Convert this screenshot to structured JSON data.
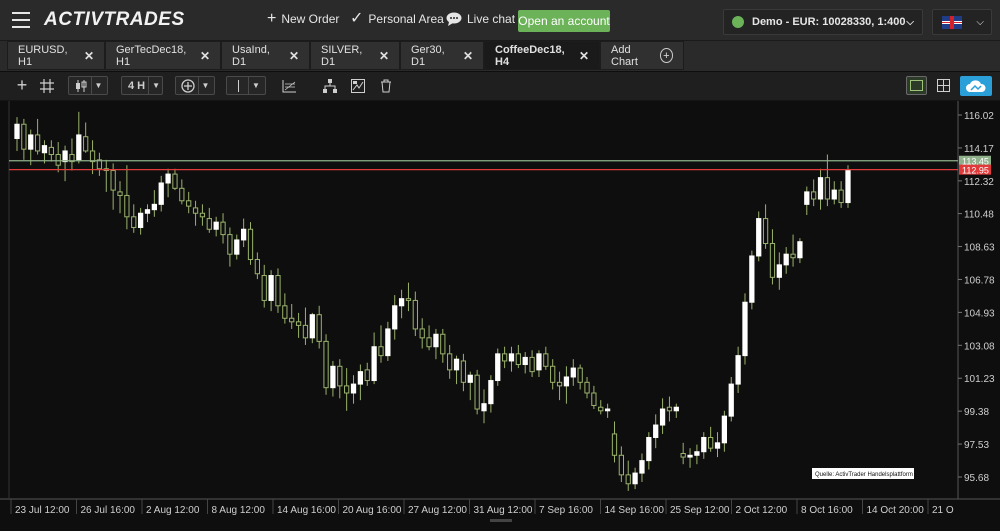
{
  "header": {
    "logo": "ACTIVTRADES",
    "new_order": "New Order",
    "personal_area": "Personal Area",
    "live_chat": "Live chat",
    "open_account": "Open an account",
    "account": "Demo - EUR: 10028330, 1:400"
  },
  "tabs": [
    {
      "label": "EURUSD, H1"
    },
    {
      "label": "GerTecDec18, H1"
    },
    {
      "label": "UsaInd, D1"
    },
    {
      "label": "SILVER, D1"
    },
    {
      "label": "Ger30, D1"
    },
    {
      "label": "CoffeeDec18, H4"
    }
  ],
  "add_chart": "Add Chart",
  "toolbar": {
    "timeframe": "4 H"
  },
  "chart_data": {
    "type": "candlestick",
    "y_ticks": [
      116.02,
      114.17,
      112.32,
      110.48,
      108.63,
      106.78,
      104.93,
      103.08,
      101.23,
      99.38,
      97.53,
      95.68
    ],
    "ylim": [
      94.5,
      116.8
    ],
    "x_ticks": [
      "23 Jul 12:00",
      "26 Jul 16:00",
      "2 Aug 12:00",
      "8 Aug 12:00",
      "14 Aug 16:00",
      "20 Aug 16:00",
      "27 Aug 12:00",
      "31 Aug 12:00",
      "7 Sep 16:00",
      "14 Sep 16:00",
      "25 Sep 12:00",
      "2 Oct 12:00",
      "8 Oct 16:00",
      "14 Oct 20:00",
      "21 O"
    ],
    "lines": [
      {
        "price": 113.45,
        "label": "113.45",
        "color": "#8fb08a"
      },
      {
        "price": 112.95,
        "label": "112.95",
        "color": "#e03a3a"
      }
    ],
    "watermark": "Quelle: ActivTrader Handelsplattform",
    "candles": [
      [
        114.7,
        115.9,
        114.0,
        115.5
      ],
      [
        115.5,
        115.8,
        113.5,
        114.1
      ],
      [
        114.1,
        115.2,
        113.2,
        114.9
      ],
      [
        114.9,
        115.8,
        113.8,
        114.0
      ],
      [
        113.9,
        114.6,
        113.3,
        114.3
      ],
      [
        114.2,
        114.6,
        113.4,
        113.8
      ],
      [
        113.8,
        114.5,
        112.8,
        113.2
      ],
      [
        113.4,
        114.3,
        112.3,
        114.0
      ],
      [
        113.8,
        114.7,
        112.9,
        113.4
      ],
      [
        113.5,
        116.2,
        113.3,
        114.9
      ],
      [
        114.8,
        115.6,
        113.9,
        114.0
      ],
      [
        114.0,
        114.6,
        112.7,
        113.4
      ],
      [
        113.5,
        113.9,
        112.6,
        113.0
      ],
      [
        113.0,
        113.5,
        111.7,
        112.9
      ],
      [
        112.9,
        113.3,
        110.7,
        111.8
      ],
      [
        111.7,
        112.3,
        110.5,
        111.5
      ],
      [
        111.5,
        113.2,
        109.6,
        110.3
      ],
      [
        110.3,
        111.0,
        109.4,
        109.7
      ],
      [
        109.7,
        110.8,
        109.3,
        110.5
      ],
      [
        110.5,
        111.0,
        110.0,
        110.7
      ],
      [
        110.7,
        111.8,
        110.3,
        111.0
      ],
      [
        111.0,
        112.6,
        110.6,
        112.2
      ],
      [
        112.2,
        113.0,
        111.4,
        112.7
      ],
      [
        112.7,
        113.0,
        111.8,
        111.9
      ],
      [
        111.9,
        112.4,
        111.0,
        111.2
      ],
      [
        111.2,
        111.7,
        110.5,
        110.9
      ],
      [
        110.8,
        111.2,
        109.8,
        110.5
      ],
      [
        110.5,
        111.0,
        109.8,
        110.3
      ],
      [
        110.2,
        110.8,
        109.4,
        109.6
      ],
      [
        109.6,
        110.3,
        109.2,
        110.0
      ],
      [
        110.0,
        110.5,
        108.8,
        109.3
      ],
      [
        109.3,
        109.7,
        107.5,
        108.2
      ],
      [
        108.2,
        109.3,
        107.9,
        109.0
      ],
      [
        109.0,
        110.2,
        108.6,
        109.6
      ],
      [
        109.6,
        110.0,
        107.6,
        107.9
      ],
      [
        107.9,
        108.3,
        106.8,
        107.1
      ],
      [
        107.0,
        107.6,
        105.2,
        105.6
      ],
      [
        105.6,
        107.3,
        105.0,
        107.0
      ],
      [
        107.0,
        107.4,
        104.9,
        105.3
      ],
      [
        105.3,
        106.0,
        104.3,
        104.6
      ],
      [
        104.6,
        105.4,
        104.0,
        104.4
      ],
      [
        104.4,
        104.9,
        103.5,
        104.2
      ],
      [
        104.2,
        105.2,
        103.1,
        103.5
      ],
      [
        103.5,
        104.9,
        103.2,
        104.8
      ],
      [
        104.8,
        105.3,
        102.9,
        103.3
      ],
      [
        103.3,
        103.7,
        100.3,
        100.7
      ],
      [
        100.7,
        102.2,
        100.2,
        101.9
      ],
      [
        101.9,
        102.3,
        100.1,
        100.8
      ],
      [
        100.8,
        101.8,
        99.4,
        100.4
      ],
      [
        100.4,
        101.4,
        99.8,
        100.9
      ],
      [
        100.9,
        102.0,
        100.0,
        101.6
      ],
      [
        101.7,
        102.1,
        100.8,
        101.1
      ],
      [
        101.1,
        103.8,
        100.9,
        103.0
      ],
      [
        103.0,
        104.2,
        102.1,
        102.5
      ],
      [
        102.5,
        104.4,
        102.2,
        104.0
      ],
      [
        104.0,
        105.9,
        103.4,
        105.3
      ],
      [
        105.3,
        106.2,
        104.6,
        105.7
      ],
      [
        105.7,
        106.6,
        105.0,
        105.6
      ],
      [
        105.6,
        106.1,
        103.6,
        104.0
      ],
      [
        104.0,
        104.6,
        102.9,
        103.5
      ],
      [
        103.5,
        104.2,
        102.8,
        103.0
      ],
      [
        103.0,
        104.0,
        102.3,
        103.7
      ],
      [
        103.7,
        104.0,
        102.1,
        102.6
      ],
      [
        102.6,
        103.1,
        101.2,
        101.7
      ],
      [
        101.7,
        102.5,
        100.9,
        102.3
      ],
      [
        102.2,
        102.6,
        100.5,
        101.0
      ],
      [
        101.0,
        101.6,
        100.0,
        101.4
      ],
      [
        101.4,
        101.7,
        99.2,
        99.5
      ],
      [
        99.4,
        100.6,
        98.7,
        99.8
      ],
      [
        99.8,
        101.4,
        99.3,
        101.1
      ],
      [
        101.1,
        102.9,
        100.8,
        102.6
      ],
      [
        102.6,
        103.0,
        101.8,
        102.2
      ],
      [
        102.2,
        103.0,
        101.6,
        102.6
      ],
      [
        102.6,
        103.1,
        101.8,
        102.0
      ],
      [
        102.0,
        102.7,
        101.5,
        102.4
      ],
      [
        102.4,
        102.8,
        101.3,
        101.6
      ],
      [
        101.7,
        102.8,
        101.3,
        102.6
      ],
      [
        102.6,
        103.0,
        101.7,
        101.9
      ],
      [
        101.9,
        102.3,
        100.6,
        101.0
      ],
      [
        101.0,
        101.6,
        100.0,
        100.8
      ],
      [
        100.8,
        101.9,
        99.8,
        101.3
      ],
      [
        101.3,
        102.3,
        100.8,
        101.8
      ],
      [
        101.8,
        102.0,
        100.6,
        101.0
      ],
      [
        101.0,
        101.3,
        100.1,
        100.4
      ],
      [
        100.4,
        100.8,
        99.5,
        99.7
      ],
      [
        99.6,
        100.0,
        99.2,
        99.4
      ],
      [
        99.4,
        99.8,
        99.0,
        99.5
      ],
      [
        98.1,
        98.8,
        96.5,
        96.9
      ],
      [
        96.9,
        97.4,
        95.4,
        95.8
      ],
      [
        95.8,
        96.6,
        94.9,
        95.3
      ],
      [
        95.3,
        96.2,
        95.0,
        95.9
      ],
      [
        95.9,
        97.0,
        95.4,
        96.6
      ],
      [
        96.6,
        98.2,
        96.1,
        97.9
      ],
      [
        97.9,
        99.2,
        97.3,
        98.6
      ],
      [
        98.6,
        100.1,
        98.1,
        99.5
      ],
      [
        99.6,
        100.2,
        98.8,
        99.4
      ],
      [
        99.4,
        99.8,
        99.0,
        99.6
      ],
      [
        97.0,
        97.6,
        96.4,
        96.8
      ],
      [
        96.8,
        97.3,
        96.2,
        96.9
      ],
      [
        96.9,
        97.5,
        96.4,
        97.1
      ],
      [
        97.1,
        98.2,
        96.7,
        97.9
      ],
      [
        97.9,
        98.5,
        97.1,
        97.3
      ],
      [
        97.3,
        98.2,
        96.8,
        97.6
      ],
      [
        97.6,
        99.4,
        97.1,
        99.1
      ],
      [
        99.1,
        101.3,
        98.8,
        100.9
      ],
      [
        100.9,
        103.0,
        100.4,
        102.5
      ],
      [
        102.5,
        106.0,
        102.0,
        105.5
      ],
      [
        105.5,
        108.4,
        105.1,
        108.1
      ],
      [
        108.1,
        110.6,
        107.8,
        110.2
      ],
      [
        110.2,
        111.0,
        108.5,
        108.8
      ],
      [
        108.8,
        109.6,
        106.5,
        106.9
      ],
      [
        106.9,
        108.3,
        106.2,
        107.6
      ],
      [
        107.6,
        108.6,
        107.1,
        108.2
      ],
      [
        108.2,
        109.3,
        107.5,
        108.0
      ],
      [
        108.0,
        109.1,
        107.7,
        108.9
      ],
      [
        111.0,
        112.0,
        110.4,
        111.7
      ],
      [
        111.7,
        112.4,
        110.9,
        111.3
      ],
      [
        111.3,
        113.0,
        110.7,
        112.5
      ],
      [
        112.5,
        113.8,
        110.9,
        111.3
      ],
      [
        111.3,
        112.3,
        111.0,
        111.8
      ],
      [
        111.8,
        112.3,
        110.8,
        111.1
      ],
      [
        111.1,
        113.2,
        110.8,
        112.9
      ]
    ]
  }
}
